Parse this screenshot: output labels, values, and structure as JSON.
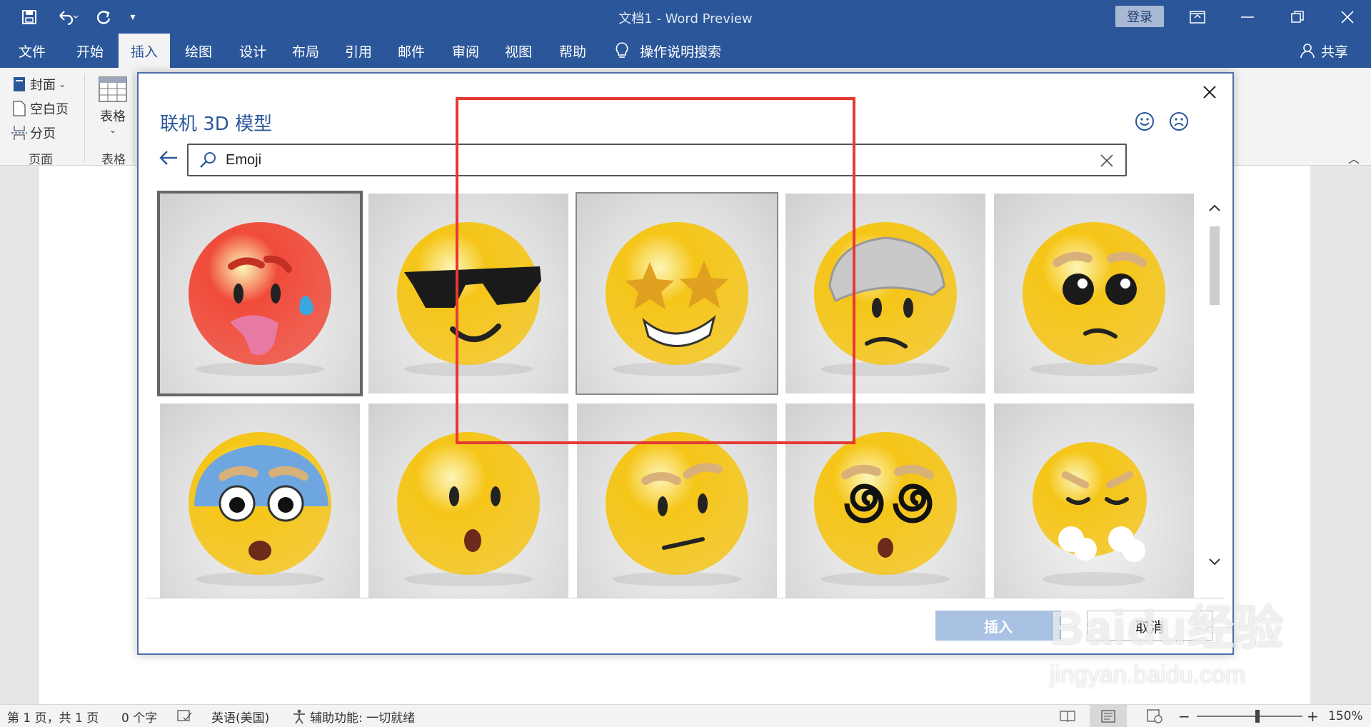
{
  "window": {
    "title": "文档1 - Word Preview",
    "login_label": "登录",
    "share_label": "共享"
  },
  "tabs": [
    "文件",
    "开始",
    "插入",
    "绘图",
    "设计",
    "布局",
    "引用",
    "邮件",
    "审阅",
    "视图",
    "帮助"
  ],
  "active_tab": "插入",
  "tell_me": "操作说明搜索",
  "ribbon": {
    "cover_label": "封面",
    "blank_page_label": "空白页",
    "page_break_label": "分页",
    "pages_group_label": "页面",
    "table_label": "表格",
    "table_group_label": "表格"
  },
  "dialog": {
    "title": "联机 3D 模型",
    "search_value": "Emoji",
    "insert_label": "插入",
    "cancel_label": "取消",
    "tiles": [
      {
        "name": "hot-face",
        "face": "#f04b3a"
      },
      {
        "name": "sunglasses-face",
        "face": "#f5c518"
      },
      {
        "name": "star-struck-face",
        "face": "#f5c518"
      },
      {
        "name": "bandaged-face",
        "face": "#f5c518"
      },
      {
        "name": "pleading-face",
        "face": "#f5c518"
      },
      {
        "name": "cold-face",
        "face": "#f5c518"
      },
      {
        "name": "surprised-face",
        "face": "#f5c518"
      },
      {
        "name": "raised-eyebrow-face",
        "face": "#f5c518"
      },
      {
        "name": "dizzy-face",
        "face": "#f5c518"
      },
      {
        "name": "steam-nose-face",
        "face": "#f5c518"
      }
    ],
    "selected_tile": 0
  },
  "status": {
    "page_info": "第 1 页，共 1 页",
    "word_count": "0 个字",
    "language": "英语(美国)",
    "accessibility": "辅助功能: 一切就绪",
    "zoom": "150%"
  },
  "watermark": {
    "logo": "Baidu经验",
    "url": "jingyan.baidu.com"
  },
  "colors": {
    "brand": "#2b579a",
    "annotation": "#e53935"
  }
}
